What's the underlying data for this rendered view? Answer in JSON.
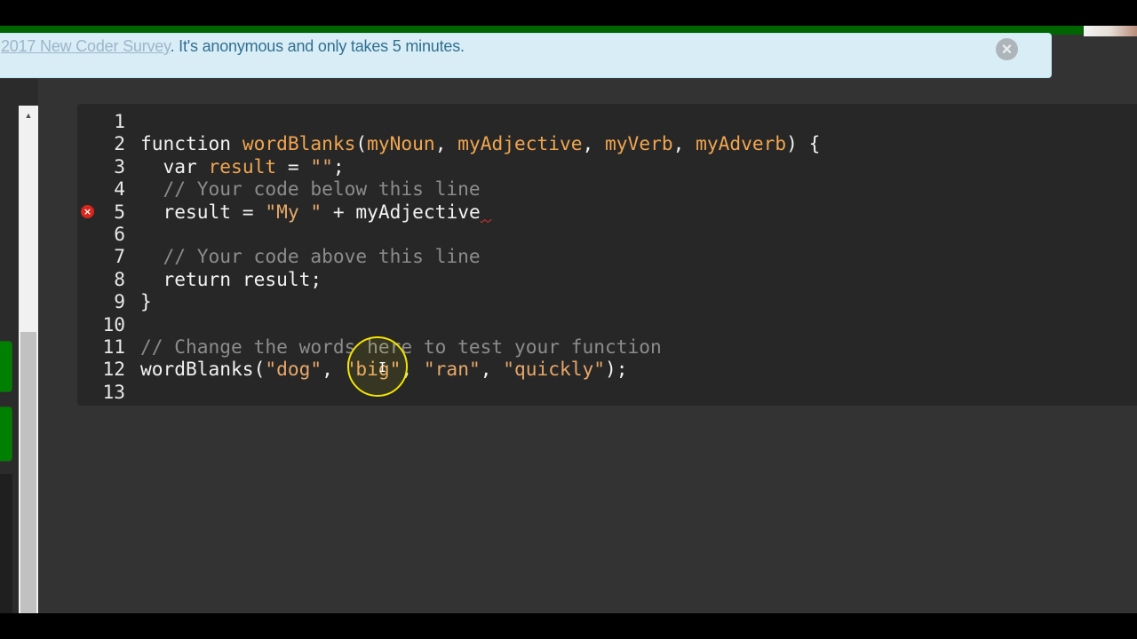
{
  "banner": {
    "link_text": "2017 New Coder Survey",
    "text": ". It's anonymous and only takes 5 minutes.",
    "close_icon": "close-circle-icon"
  },
  "editor": {
    "lines": [
      {
        "n": "1",
        "tokens": []
      },
      {
        "n": "2",
        "tokens": [
          {
            "t": "function ",
            "c": "plain"
          },
          {
            "t": "wordBlanks",
            "c": "fn"
          },
          {
            "t": "(",
            "c": "plain"
          },
          {
            "t": "myNoun",
            "c": "param"
          },
          {
            "t": ", ",
            "c": "plain"
          },
          {
            "t": "myAdjective",
            "c": "param"
          },
          {
            "t": ", ",
            "c": "plain"
          },
          {
            "t": "myVerb",
            "c": "param"
          },
          {
            "t": ", ",
            "c": "plain"
          },
          {
            "t": "myAdverb",
            "c": "param"
          },
          {
            "t": ") {",
            "c": "plain"
          }
        ]
      },
      {
        "n": "3",
        "tokens": [
          {
            "t": "  var ",
            "c": "plain"
          },
          {
            "t": "result",
            "c": "param"
          },
          {
            "t": " = ",
            "c": "plain"
          },
          {
            "t": "\"\"",
            "c": "str"
          },
          {
            "t": ";",
            "c": "plain"
          }
        ]
      },
      {
        "n": "4",
        "tokens": [
          {
            "t": "  // Your code below this line",
            "c": "cm"
          }
        ]
      },
      {
        "n": "5",
        "error": true,
        "tokens": [
          {
            "t": "  result = ",
            "c": "plain"
          },
          {
            "t": "\"My \"",
            "c": "str"
          },
          {
            "t": " + ",
            "c": "plain"
          },
          {
            "t": "myAdjective",
            "c": "plain"
          },
          {
            "t": " ",
            "c": "squiggle"
          }
        ]
      },
      {
        "n": "6",
        "tokens": []
      },
      {
        "n": "7",
        "tokens": [
          {
            "t": "  // Your code above this line",
            "c": "cm"
          }
        ]
      },
      {
        "n": "8",
        "tokens": [
          {
            "t": "  return ",
            "c": "plain"
          },
          {
            "t": "result",
            "c": "plain"
          },
          {
            "t": ";",
            "c": "plain"
          }
        ]
      },
      {
        "n": "9",
        "tokens": [
          {
            "t": "}",
            "c": "plain"
          }
        ]
      },
      {
        "n": "10",
        "tokens": []
      },
      {
        "n": "11",
        "tokens": [
          {
            "t": "// Change the words here to test your function",
            "c": "cm"
          }
        ]
      },
      {
        "n": "12",
        "tokens": [
          {
            "t": "wordBlanks",
            "c": "plain"
          },
          {
            "t": "(",
            "c": "plain"
          },
          {
            "t": "\"dog\"",
            "c": "str"
          },
          {
            "t": ", ",
            "c": "plain"
          },
          {
            "t": "\"big\"",
            "c": "str"
          },
          {
            "t": ", ",
            "c": "plain"
          },
          {
            "t": "\"ran\"",
            "c": "str"
          },
          {
            "t": ", ",
            "c": "plain"
          },
          {
            "t": "\"quickly\"",
            "c": "str"
          },
          {
            "t": ");",
            "c": "plain"
          }
        ]
      },
      {
        "n": "13",
        "tokens": []
      }
    ],
    "error_icon": "error-x-icon",
    "cursor_glyph": "I"
  },
  "colors": {
    "topbar": "#006400",
    "banner_bg": "#d9edf7",
    "editor_bg": "#272727",
    "cursor_highlight": "#f3e400"
  }
}
